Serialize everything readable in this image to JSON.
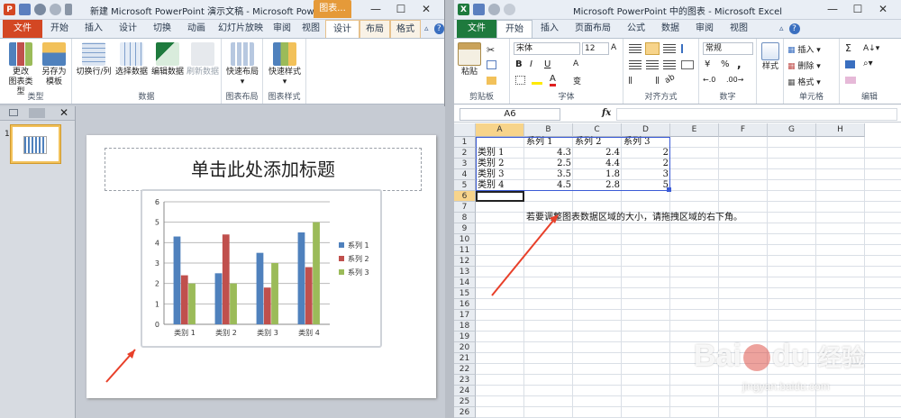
{
  "ppt": {
    "app_icon": "P",
    "title": "新建 Microsoft PowerPoint 演示文稿 - Microsoft Powe...",
    "context_tab_group": "图表...",
    "tabs": [
      "文件",
      "开始",
      "插入",
      "设计",
      "切换",
      "动画",
      "幻灯片放映",
      "审阅",
      "视图",
      "设计",
      "布局",
      "格式"
    ],
    "ribbon": {
      "buttons": [
        {
          "label1": "更改",
          "label2": "图表类型"
        },
        {
          "label1": "另存为",
          "label2": "模板"
        },
        {
          "label1": "切换行/列",
          "label2": ""
        },
        {
          "label1": "选择数据",
          "label2": ""
        },
        {
          "label1": "编辑数据",
          "label2": ""
        },
        {
          "label1": "刷新数据",
          "label2": ""
        },
        {
          "label1": "快速布局",
          "label2": "▾"
        },
        {
          "label1": "快速样式",
          "label2": "▾"
        }
      ],
      "groups": [
        "类型",
        "数据",
        "图表布局",
        "图表样式"
      ]
    },
    "slide_number": "1",
    "slide_title_placeholder": "单击此处添加标题"
  },
  "xl": {
    "app_icon": "X",
    "title": "Microsoft PowerPoint 中的图表 - Microsoft Excel",
    "tabs": [
      "文件",
      "开始",
      "插入",
      "页面布局",
      "公式",
      "数据",
      "审阅",
      "视图"
    ],
    "ribbon": {
      "paste": "粘贴",
      "font_name": "宋体",
      "font_size": "12",
      "number_format": "常规",
      "style": "样式",
      "insert": "插入",
      "delete": "删除",
      "format": "格式",
      "groups": [
        "剪贴板",
        "字体",
        "对齐方式",
        "数字",
        "单元格",
        "编辑"
      ],
      "sym_bold": "B",
      "sym_italic": "I",
      "sym_underline": "U",
      "sym_font_size_inc": "A",
      "sym_font_size_dec": "A",
      "sym_font_color": "A",
      "sym_currency": "¥",
      "sym_percent": "%",
      "sym_comma": ",",
      "sym_increase_decimal": "←.0",
      "sym_decrease_decimal": ".00→",
      "sym_sum": "Σ"
    },
    "name_box": "A6",
    "fx_label": "fx",
    "columns": [
      "A",
      "B",
      "C",
      "D",
      "E",
      "F",
      "G",
      "H"
    ],
    "rows": [
      "1",
      "2",
      "3",
      "4",
      "5",
      "6",
      "7",
      "8",
      "9",
      "10",
      "11",
      "12",
      "13",
      "14",
      "15",
      "16",
      "17",
      "18",
      "19",
      "20",
      "21",
      "22",
      "23",
      "24",
      "25",
      "26"
    ],
    "cells": {
      "B1": "系列 1",
      "C1": "系列 2",
      "D1": "系列 3",
      "A2": "类别 1",
      "B2": "4.3",
      "C2": "2.4",
      "D2": "2",
      "A3": "类别 2",
      "B3": "2.5",
      "C3": "4.4",
      "D3": "2",
      "A4": "类别 3",
      "B4": "3.5",
      "C4": "1.8",
      "D4": "3",
      "A5": "类别 4",
      "B5": "4.5",
      "C5": "2.8",
      "D5": "5"
    },
    "note": "若要调整图表数据区域的大小，请拖拽区域的右下角。"
  },
  "chart_data": {
    "type": "bar",
    "categories": [
      "类别 1",
      "类别 2",
      "类别 3",
      "类别 4"
    ],
    "series": [
      {
        "name": "系列 1",
        "values": [
          4.3,
          2.5,
          3.5,
          4.5
        ],
        "color": "#4f81bd"
      },
      {
        "name": "系列 2",
        "values": [
          2.4,
          4.4,
          1.8,
          2.8
        ],
        "color": "#c0504d"
      },
      {
        "name": "系列 3",
        "values": [
          2,
          2,
          3,
          5
        ],
        "color": "#9bbb59"
      }
    ],
    "ylim": [
      0,
      6
    ],
    "yticks": [
      "0",
      "1",
      "2",
      "3",
      "4",
      "5",
      "6"
    ],
    "grid": true,
    "legend": "right"
  },
  "colors": {
    "ppt_accent": "#d34723",
    "excel_accent": "#1e7a3d",
    "context_tab": "#e59a39",
    "arrow": "#e8402a"
  },
  "watermark": {
    "brand": "Bai",
    "brand2": "du",
    "product": "经验",
    "url": "jingyan.baidu.com"
  }
}
